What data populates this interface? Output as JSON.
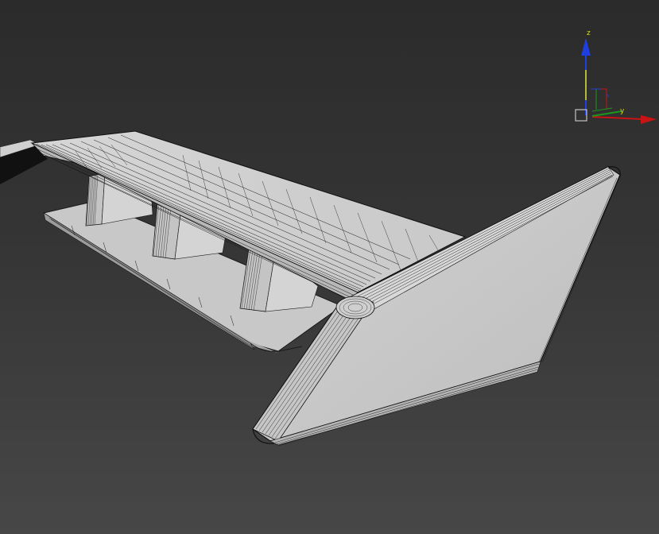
{
  "viewport": {
    "background_top": "#2b2b2b",
    "background_bottom": "#474747",
    "model": "rear-spoiler-wireframe"
  },
  "gizmo": {
    "labels": {
      "z": "z",
      "y": "y"
    },
    "colors": {
      "x": "#c81414",
      "y": "#1a9a1a",
      "z": "#1f3fe0",
      "yellow": "#e3e300"
    }
  }
}
